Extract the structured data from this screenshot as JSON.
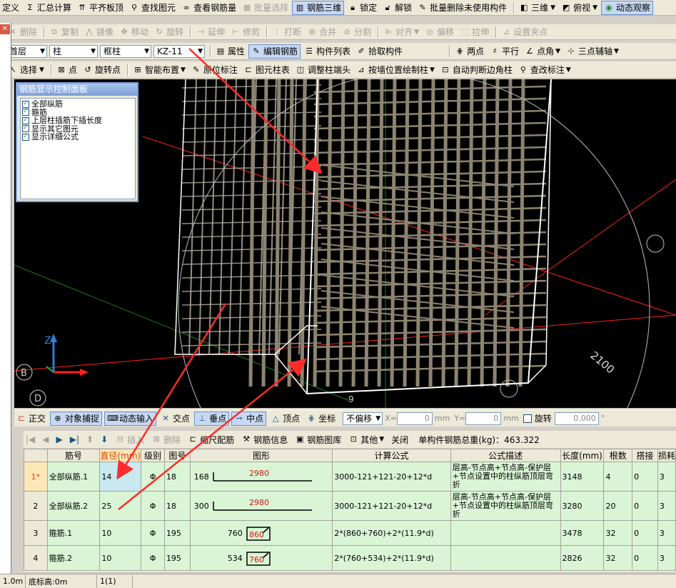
{
  "toolbar1": {
    "items": [
      "定义",
      "汇总计算",
      "平齐板顶",
      "查找图元",
      "查看钢筋量",
      "批量选择",
      "钢筋三维",
      "锁定",
      "解锁",
      "批量删除未使用构件",
      "三维",
      "俯视",
      "动态观察"
    ]
  },
  "toolbar2": {
    "items": [
      "删除",
      "复制",
      "镜像",
      "移动",
      "旋转",
      "延伸",
      "修剪",
      "打断",
      "合并",
      "分割",
      "对齐",
      "偏移",
      "拉伸",
      "设置夹点"
    ]
  },
  "toolbar3": {
    "floor": "首层",
    "type": "柱",
    "subtype": "框柱",
    "component": "KZ-11",
    "items": [
      "属性",
      "编辑钢筋",
      "构件列表",
      "拾取构件",
      "两点",
      "平行",
      "点角",
      "三点辅轴"
    ]
  },
  "toolbar4": {
    "items": [
      "选择",
      "点",
      "旋转点",
      "智能布置",
      "原位标注",
      "图元柱表",
      "调整柱端头",
      "按墙位置绘制柱",
      "自动判断边角柱",
      "查改标注"
    ]
  },
  "panel": {
    "title": "钢筋显示控制面板",
    "options": [
      "全部纵筋",
      "箍筋",
      "上层柱插筋下插长度",
      "显示其它图元",
      "显示详细公式"
    ]
  },
  "viewport": {
    "axis_z": "Z",
    "label_b": "B",
    "label_d": "D",
    "label_9": "9",
    "dimension": "2100",
    "colors": {
      "bg": "#000000",
      "rebar": "#8c8470",
      "frame": "#ffffff",
      "axis_line": "#ff2020",
      "arrow": "#ff2a2a"
    }
  },
  "snapbar": {
    "items": [
      "正交",
      "对象捕捉",
      "动态输入",
      "交点",
      "垂点",
      "中点",
      "顶点",
      "坐标"
    ],
    "offset_mode": "不偏移",
    "x_label": "X=",
    "x_value": "0",
    "y_label": "Y=",
    "y_value": "0",
    "unit": "mm",
    "rotate_label": "旋转",
    "rotate_value": "0.000"
  },
  "gridbar": {
    "items": [
      "插入",
      "删除",
      "缩尺配筋",
      "钢筋信息",
      "钢筋图库",
      "其他",
      "关闭"
    ],
    "total": "单构件钢筋总重(kg)：463.322"
  },
  "table": {
    "headers": [
      "",
      "筋号",
      "直径(mm)",
      "级别",
      "图号",
      "图形",
      "计算公式",
      "公式描述",
      "长度(mm)",
      "根数",
      "搭接",
      "损耗"
    ],
    "rows": [
      {
        "no": "1*",
        "name": "全部纵筋.1",
        "dia": "14",
        "grade": "Φ",
        "fig": "18",
        "shape_left": "168",
        "shape_mid": "2980",
        "formula": "3000-121+121-20+12*d",
        "desc": "层高-节点高+节点高-保护层+节点设置中的柱纵筋顶层弯折",
        "length": "3148",
        "count": "4",
        "lap": "0",
        "loss": "3"
      },
      {
        "no": "2",
        "name": "全部纵筋.2",
        "dia": "25",
        "grade": "Φ",
        "fig": "18",
        "shape_left": "300",
        "shape_mid": "2980",
        "formula": "3000-121+121-20+12*d",
        "desc": "层高-节点高+节点高-保护层+节点设置中的柱纵筋顶层弯折",
        "length": "3280",
        "count": "20",
        "lap": "0",
        "loss": "3"
      },
      {
        "no": "3",
        "name": "箍筋.1",
        "dia": "10",
        "grade": "Φ",
        "fig": "195",
        "shape_left": "760",
        "shape_mid": "860",
        "formula": "2*(860+760)+2*(11.9*d)",
        "desc": "",
        "length": "3478",
        "count": "32",
        "lap": "0",
        "loss": "3"
      },
      {
        "no": "4",
        "name": "箍筋.2",
        "dia": "10",
        "grade": "Φ",
        "fig": "195",
        "shape_left": "534",
        "shape_mid": "760",
        "formula": "2*(760+534)+2*(11.9*d)",
        "desc": "",
        "length": "2826",
        "count": "32",
        "lap": "0",
        "loss": "3"
      }
    ]
  },
  "status": {
    "c1": "1.0m",
    "c2": "底标高:0m",
    "c3": "1(1)"
  }
}
